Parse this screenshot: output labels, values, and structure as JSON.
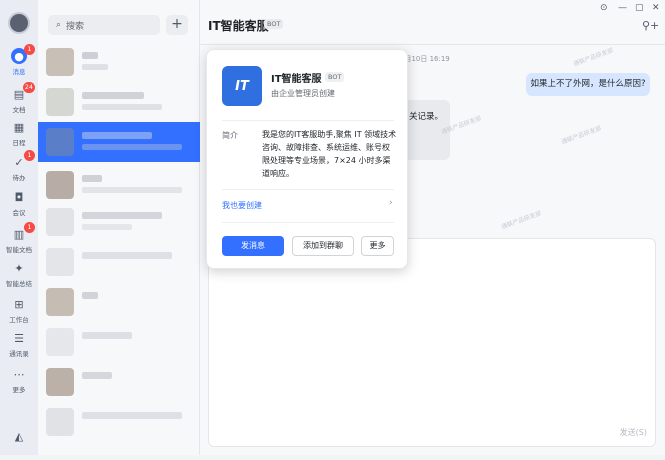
{
  "sidebar": {
    "items": [
      {
        "label": "消息",
        "badge": "1",
        "icon": "chat-icon"
      },
      {
        "label": "文档",
        "badge": "24",
        "icon": "doc-icon"
      },
      {
        "label": "日程",
        "badge": "",
        "icon": "calendar-icon"
      },
      {
        "label": "待办",
        "badge": "1",
        "icon": "todo-icon"
      },
      {
        "label": "会议",
        "badge": "",
        "icon": "video-icon"
      },
      {
        "label": "智能文档",
        "badge": "1",
        "icon": "smart-doc-icon"
      },
      {
        "label": "智能总结",
        "badge": "",
        "icon": "sparkle-icon"
      },
      {
        "label": "工作台",
        "badge": "",
        "icon": "grid-icon"
      },
      {
        "label": "通讯录",
        "badge": "",
        "icon": "contacts-icon"
      },
      {
        "label": "更多",
        "badge": "",
        "icon": "more-icon"
      }
    ]
  },
  "search": {
    "placeholder": "搜索"
  },
  "chat": {
    "title": "IT智能客服",
    "tag": "BOT",
    "timestamp": "4月10日 16:19",
    "user_message": "如果上不了外网，是什么原因?",
    "bot_message_fragment": "关记录。",
    "send_label": "发送(S)",
    "watermark": "通联产品研发部",
    "accent": "#3370ff"
  },
  "card": {
    "logo_text": "IT",
    "name": "IT智能客服",
    "tag": "BOT",
    "creator": "由企业管理员创建",
    "intro_label": "简介",
    "intro_text": "我是您的IT客服助手,聚焦 IT 领域技术咨询、故障排查、系统运维、账号权限处理等专业场景，7×24 小时多渠道响应。",
    "create_link": "我也要创建",
    "btn_send": "发消息",
    "btn_add_group": "添加到群聊",
    "btn_more": "更多"
  }
}
